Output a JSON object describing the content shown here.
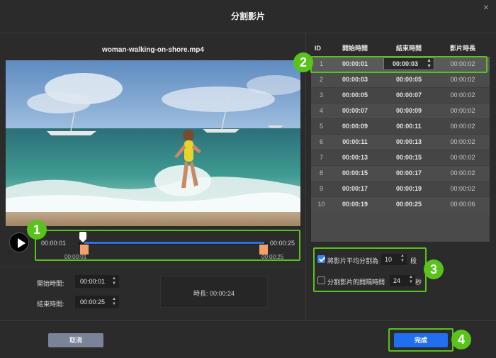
{
  "dialog": {
    "title": "分割影片",
    "close_icon": "×"
  },
  "video": {
    "filename": "woman-walking-on-shore.mp4"
  },
  "timeline": {
    "start_time": "00:00:01",
    "end_time": "00:00:25",
    "start_marker": "00:00:01",
    "end_marker": "00:00:25"
  },
  "fields": {
    "start_label": "開始時間:",
    "start_value": "00:00:01",
    "end_label": "結束時間:",
    "end_value": "00:00:25",
    "duration": "時長:  00:00:24"
  },
  "table": {
    "headers": {
      "id": "ID",
      "start": "開始時間",
      "end": "結束時間",
      "length": "影片時長"
    },
    "rows": [
      {
        "id": "1",
        "start": "00:00:01",
        "end": "00:00:03",
        "length": "00:00:02"
      },
      {
        "id": "2",
        "start": "00:00:03",
        "end": "00:00:05",
        "length": "00:00:02"
      },
      {
        "id": "3",
        "start": "00:00:05",
        "end": "00:00:07",
        "length": "00:00:02"
      },
      {
        "id": "4",
        "start": "00:00:07",
        "end": "00:00:09",
        "length": "00:00:02"
      },
      {
        "id": "5",
        "start": "00:00:09",
        "end": "00:00:11",
        "length": "00:00:02"
      },
      {
        "id": "6",
        "start": "00:00:11",
        "end": "00:00:13",
        "length": "00:00:02"
      },
      {
        "id": "7",
        "start": "00:00:13",
        "end": "00:00:15",
        "length": "00:00:02"
      },
      {
        "id": "8",
        "start": "00:00:15",
        "end": "00:00:17",
        "length": "00:00:02"
      },
      {
        "id": "9",
        "start": "00:00:17",
        "end": "00:00:19",
        "length": "00:00:02"
      },
      {
        "id": "10",
        "start": "00:00:19",
        "end": "00:00:25",
        "length": "00:00:06"
      }
    ]
  },
  "options": {
    "split_even_label": "將影片平均分割為",
    "split_even_value": "10",
    "split_even_unit": "段",
    "split_even_checked": true,
    "split_interval_label": "分割影片的間隔時間",
    "split_interval_value": "24",
    "split_interval_unit": "秒",
    "split_interval_checked": false
  },
  "buttons": {
    "cancel": "取消",
    "done": "完成"
  },
  "annotations": {
    "badge1": "1",
    "badge2": "2",
    "badge3": "3",
    "badge4": "4"
  },
  "colors": {
    "accent_green": "#59c21b",
    "primary_blue": "#1f6ff0",
    "handle_orange": "#f4a06a"
  }
}
